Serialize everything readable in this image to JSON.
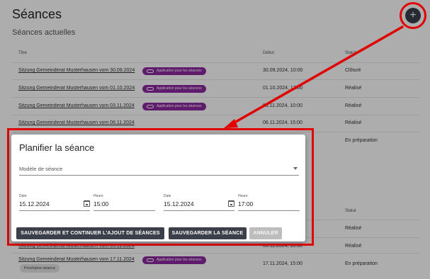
{
  "page": {
    "title": "Séances",
    "section_title": "Séances actuelles",
    "add_icon": "+"
  },
  "table": {
    "headers": {
      "title": "Titre",
      "start": "Début",
      "status": "Statut"
    },
    "chip_label": "Application pour les séances",
    "rows": [
      {
        "title": "Sitzung Gemeinderat Musterhausen vom 30.09.2024",
        "date": "30.09.2024, 10:00",
        "status": "Clôturé",
        "has_chip": true
      },
      {
        "title": "Sitzung Gemeinderat Musterhausen vom 01.10.2024",
        "date": "01.10.2024, 17:00",
        "status": "Réalisé",
        "has_chip": true
      },
      {
        "title": "Sitzung Gemeinderat Musterhausen vom 03.11.2024",
        "date": "03.11.2024, 10:00",
        "status": "Réalisé",
        "has_chip": true
      },
      {
        "title": "Sitzung Gemeinderat Musterhausen vom 06.11.2024",
        "date": "06.11.2024, 15:00",
        "status": "Réalisé",
        "has_chip": false
      },
      {
        "title": "Sitzung Gemeinderat Musterhausen vom 17.11.2024",
        "date": "17.11.2024, 15:00",
        "status": "En préparation",
        "has_chip": true
      }
    ],
    "status_partial": "En préparation",
    "lower_status_header": "Statut",
    "lower_rows": [
      {
        "status": "Réalisé"
      },
      {
        "title": "Sitzung Gemeinderat Musterhausen vom 06.11.2024",
        "date": "06.11.2024, 15:00",
        "status": "Réalisé"
      }
    ],
    "next_chip": "Prochaine séance"
  },
  "dialog": {
    "title": "Planifier la séance",
    "template_placeholder": "Modèle de séance",
    "start_date_label": "Date",
    "start_date_value": "15.12.2024",
    "start_time_label": "Heure",
    "start_time_value": "15:00",
    "end_date_label": "Date",
    "end_date_value": "15.12.2024",
    "end_time_label": "Heure",
    "end_time_value": "17:00",
    "btn_save_continue": "SAUVEGARDER ET CONTINUER L'AJOUT DE SÉANCES",
    "btn_save": "SAUVEGARDER LA SÉANCE",
    "btn_cancel": "ANNULER"
  },
  "colors": {
    "accent_dark": "#3a3f4a",
    "chip_purple": "#8e2aa0",
    "annotation_red": "#e00000"
  }
}
